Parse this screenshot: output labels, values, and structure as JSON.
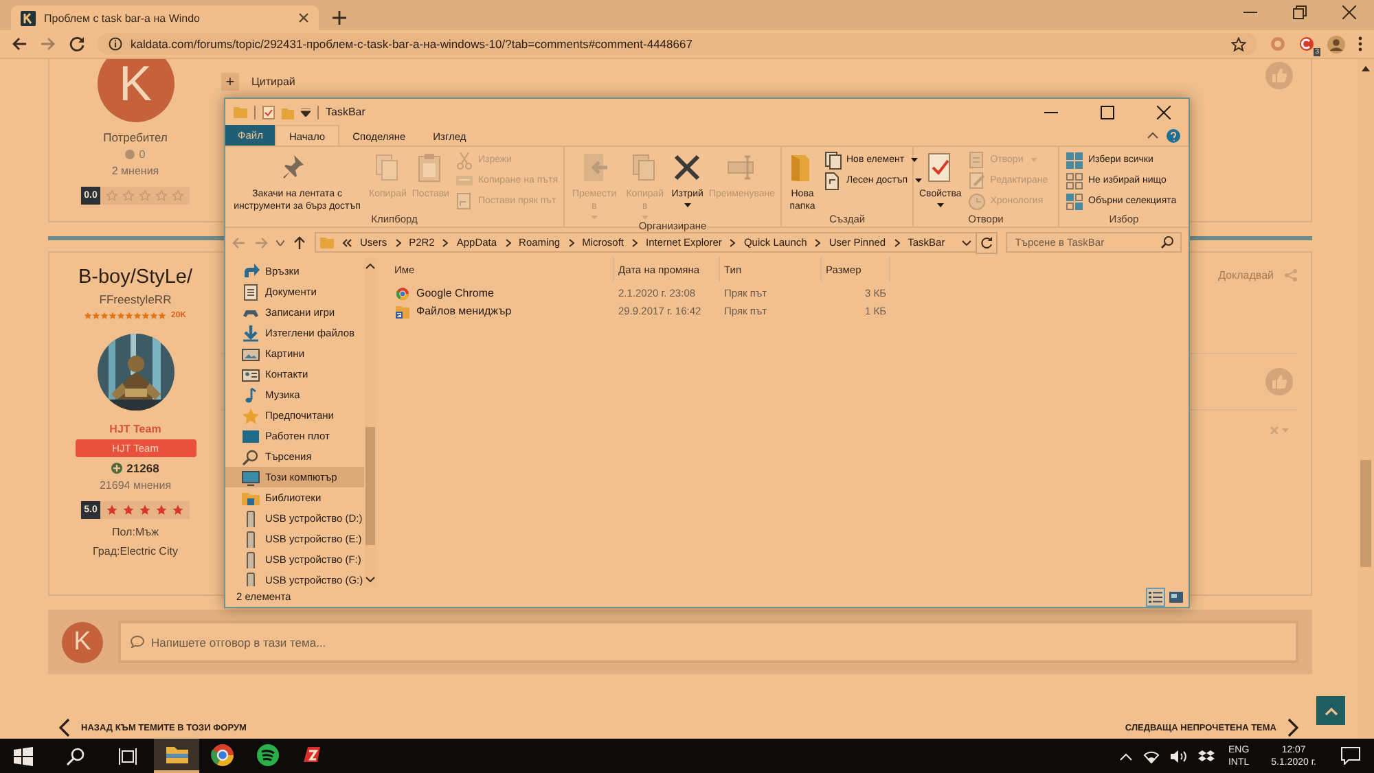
{
  "browser": {
    "tab": {
      "title": "Проблем с task bar-а на Windo",
      "selected": true
    },
    "url": "kaldata.com/forums/topic/292431-проблем-с-task-bar-а-на-windows-10/?tab=comments#comment-4448667",
    "extension_badge": "3"
  },
  "forum": {
    "posts": [
      {
        "avatar_letter": "K",
        "author_title": "Потребител",
        "points": "0",
        "posts_count": "2 мнения",
        "rating": "0.0",
        "stars": 0,
        "multiquote": "+",
        "quote": "Цитирай"
      },
      {
        "username": "B-boy/StyLe/",
        "title": "FFreestyleRR",
        "rank": {
          "stars": 10,
          "label": "20K"
        },
        "group": "HJT Team",
        "group_badge": "HJT Team",
        "points": "21268",
        "posts_count": "21694 мнения",
        "rating": "5.0",
        "stars": 5,
        "gender": "Пол:Мъж",
        "city": "Град:Electric City",
        "report": "Докладвай"
      }
    ],
    "reply": {
      "avatar_letter": "K",
      "placeholder": "Напишете отговор в тази тема..."
    },
    "prev_link": "НАЗАД КЪМ ТЕМИТЕ В ТОЗИ ФОРУМ",
    "next_link": "СЛЕДВАЩА НЕПРОЧЕТЕНА ТЕМА"
  },
  "explorer": {
    "title": "TaskBar",
    "tabs": [
      {
        "label": "Файл",
        "kind": "menu",
        "selected": false
      },
      {
        "label": "Начало",
        "kind": "tab",
        "selected": true
      },
      {
        "label": "Споделяне",
        "kind": "tab",
        "selected": false
      },
      {
        "label": "Изглед",
        "kind": "tab",
        "selected": false
      }
    ],
    "groups": [
      {
        "label": "Клипборд",
        "items": [
          {
            "label": "Закачи на лентата с инструменти за бърз достъп",
            "kind": "large",
            "disabled": false,
            "dropdown": false
          },
          {
            "label": "Копирай",
            "kind": "large",
            "disabled": true,
            "dropdown": false
          },
          {
            "label": "Постави",
            "kind": "large",
            "disabled": true,
            "dropdown": false
          },
          {
            "label": "Изрежи",
            "kind": "small",
            "disabled": true,
            "dropdown": false
          },
          {
            "label": "Копиране на пътя",
            "kind": "small",
            "disabled": true,
            "dropdown": false
          },
          {
            "label": "Постави пряк път",
            "kind": "small",
            "disabled": true,
            "dropdown": false
          }
        ]
      },
      {
        "label": "Организиране",
        "items": [
          {
            "label": "Премести в",
            "kind": "large",
            "disabled": true,
            "dropdown": true
          },
          {
            "label": "Копирай в",
            "kind": "large",
            "disabled": true,
            "dropdown": true
          },
          {
            "label": "Изтрий",
            "kind": "large",
            "disabled": false,
            "dropdown": true
          },
          {
            "label": "Преименуване",
            "kind": "large",
            "disabled": true,
            "dropdown": false
          }
        ]
      },
      {
        "label": "Създай",
        "items": [
          {
            "label": "Нова папка",
            "kind": "large",
            "disabled": false,
            "dropdown": false
          },
          {
            "label": "Нов елемент",
            "kind": "small",
            "disabled": false,
            "dropdown": true
          },
          {
            "label": "Лесен достъп",
            "kind": "small",
            "disabled": false,
            "dropdown": true
          }
        ]
      },
      {
        "label": "Отвори",
        "items": [
          {
            "label": "Свойства",
            "kind": "large",
            "disabled": false,
            "dropdown": true
          },
          {
            "label": "Отвори",
            "kind": "small",
            "disabled": true,
            "dropdown": true
          },
          {
            "label": "Редактиране",
            "kind": "small",
            "disabled": true,
            "dropdown": false
          },
          {
            "label": "Хронология",
            "kind": "small",
            "disabled": true,
            "dropdown": false
          }
        ]
      },
      {
        "label": "Избор",
        "items": [
          {
            "label": "Избери всички",
            "kind": "small",
            "disabled": false,
            "dropdown": false
          },
          {
            "label": "Не избирай нищо",
            "kind": "small",
            "disabled": false,
            "dropdown": false
          },
          {
            "label": "Обърни селекцията",
            "kind": "small",
            "disabled": false,
            "dropdown": false
          }
        ]
      }
    ],
    "path": [
      "Users",
      "P2R2",
      "AppData",
      "Roaming",
      "Microsoft",
      "Internet Explorer",
      "Quick Launch",
      "User Pinned",
      "TaskBar"
    ],
    "search_placeholder": "Търсене в TaskBar",
    "nav": [
      {
        "label": "Връзки",
        "selected": false
      },
      {
        "label": "Документи",
        "selected": false
      },
      {
        "label": "Записани игри",
        "selected": false
      },
      {
        "label": "Изтеглени файлов",
        "selected": false
      },
      {
        "label": "Картини",
        "selected": false
      },
      {
        "label": "Контакти",
        "selected": false
      },
      {
        "label": "Музика",
        "selected": false
      },
      {
        "label": "Предпочитани",
        "selected": false
      },
      {
        "label": "Работен плот",
        "selected": false
      },
      {
        "label": "Търсения",
        "selected": false
      },
      {
        "label": "Този компютър",
        "selected": true
      },
      {
        "label": "Библиотеки",
        "selected": false
      },
      {
        "label": "USB устройство (D:)",
        "selected": false
      },
      {
        "label": "USB устройство (E:)",
        "selected": false
      },
      {
        "label": "USB устройство (F:)",
        "selected": false
      },
      {
        "label": "USB устройство (G:)",
        "selected": false
      }
    ],
    "columns": [
      "Име",
      "Дата на промяна",
      "Тип",
      "Размер"
    ],
    "rows": [
      {
        "name": "Google Chrome",
        "date": "2.1.2020 г. 23:08",
        "type": "Пряк път",
        "size": "3 КБ"
      },
      {
        "name": "Файлов мениджър",
        "date": "29.9.2017 г. 16:42",
        "type": "Пряк път",
        "size": "1 КБ"
      }
    ],
    "status": "2 елемента",
    "views": [
      {
        "selected": true
      },
      {
        "selected": false
      }
    ]
  },
  "taskbar": {
    "apps": [
      {
        "selected": true
      },
      {
        "selected": false
      },
      {
        "selected": false
      },
      {
        "selected": false
      }
    ],
    "language": "ENG",
    "layout": "INTL",
    "time": "12:07",
    "date": "5.1.2020 г."
  }
}
